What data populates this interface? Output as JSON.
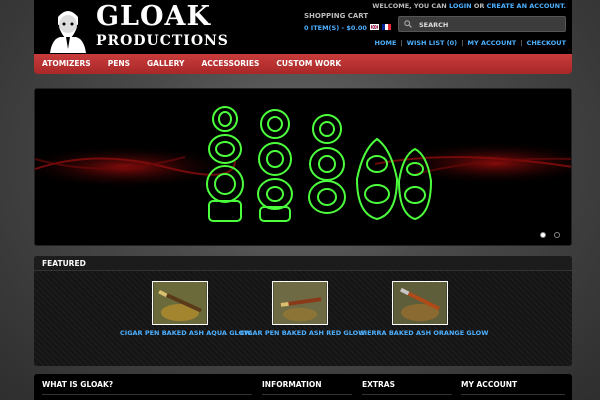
{
  "brand": {
    "line1": "GLOAK",
    "line2": "PRODUCTIONS"
  },
  "header": {
    "welcome_prefix": "WELCOME, YOU CAN",
    "login": "LOGIN",
    "or": "OR",
    "create_account": "CREATE AN ACCOUNT.",
    "cart_title": "SHOPPING CART",
    "cart_summary": "0 ITEM(S) - $0.00",
    "search_placeholder": "SEARCH",
    "links": [
      "HOME",
      "WISH LIST (0)",
      "MY ACCOUNT",
      "CHECKOUT"
    ]
  },
  "nav": [
    "ATOMIZERS",
    "PENS",
    "GALLERY",
    "ACCESSORIES",
    "CUSTOM WORK"
  ],
  "featured": {
    "title": "FEATURED",
    "products": [
      {
        "name": "CIGAR PEN BAKED ASH AQUA GLOW"
      },
      {
        "name": "CIGAR PEN BAKED ASH RED GLOW"
      },
      {
        "name": "SIERRA BAKED ASH ORANGE GLOW"
      }
    ]
  },
  "footer": {
    "columns": [
      "WHAT IS GLOAK?",
      "INFORMATION",
      "EXTRAS",
      "MY ACCOUNT"
    ]
  },
  "colors": {
    "accent": "#4db0ff",
    "nav": "#b83232",
    "glow": "#4cff3c"
  },
  "icons": {
    "search": "search-icon",
    "dropdown": "chevron-down-icon"
  }
}
